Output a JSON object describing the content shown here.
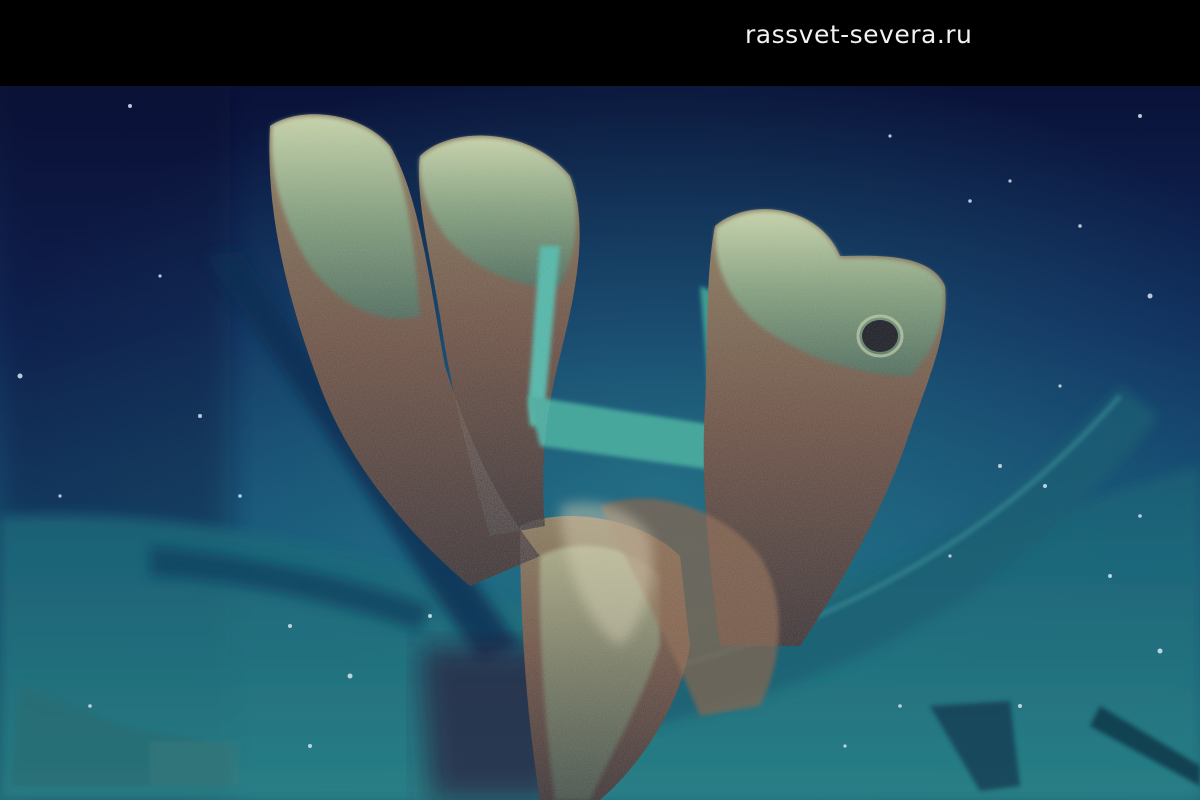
{
  "watermark": {
    "text": "rassvet-severa.ru"
  },
  "photo": {
    "subject": "deep-sea-shipwreck",
    "colors": {
      "water_top": "#0b1640",
      "water_mid": "#123d6e",
      "seabed": "#1f6f7d",
      "wreck_dark": "#3c3a3a",
      "wreck_rust": "#7a5a48",
      "growth_green": "#9bb39a",
      "verdigris": "#4fb3a6",
      "hull_shadow": "#0d2a44"
    }
  }
}
